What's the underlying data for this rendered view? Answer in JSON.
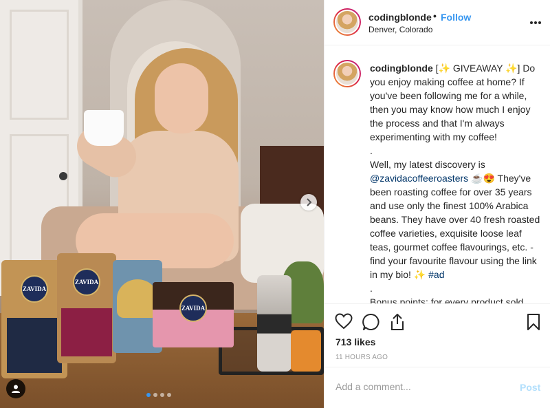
{
  "post": {
    "author": {
      "username": "codingblonde",
      "location": "Denver, Colorado",
      "follow_label": "Follow",
      "bullet": "•"
    },
    "photo": {
      "bag_labels": [
        "ZAVIDA",
        "ZAVIDA",
        "ZAVIDA"
      ],
      "box_label": "ZAVIDA",
      "carousel_total": 4,
      "carousel_active": 0
    },
    "caption": {
      "username": "codingblonde",
      "p1_text": "[✨ GIVEAWAY ✨] Do you enjoy making coffee at home? If you've been following me for a while, then you may know how much I enjoy the process and that I'm always experimenting with my coffee!",
      "sep1": ".",
      "p2_before": "Well, my latest discovery is",
      "p2_mention": "@zavidacoffeeroasters",
      "p2_after": "☕😍 They've been roasting coffee for over 35 years and use only the finest 100% Arabica beans. They have over 40 fresh roasted coffee varieties, exquisite loose leaf teas, gourmet coffee flavourings, etc. - find your favourite flavour using the link in my bio! ✨",
      "p2_hashtag": "#ad",
      "sep2": ".",
      "p3_text": "Bonus points: for every product sold they plant a tree within rural communities and developing countries!"
    },
    "likes": "713 likes",
    "time": "11 HOURS AGO",
    "comment": {
      "placeholder": "Add a comment...",
      "post_label": "Post"
    }
  },
  "icons": {
    "more": "more-options-icon",
    "heart": "heart-icon",
    "comment": "comment-icon",
    "share": "share-icon",
    "save": "bookmark-icon",
    "next": "chevron-right-icon",
    "tag": "user-tag-icon"
  },
  "colors": {
    "follow": "#3897f0",
    "mention": "#003569",
    "post_disabled": "#b2dffc",
    "story_ring": "#dc2743"
  }
}
